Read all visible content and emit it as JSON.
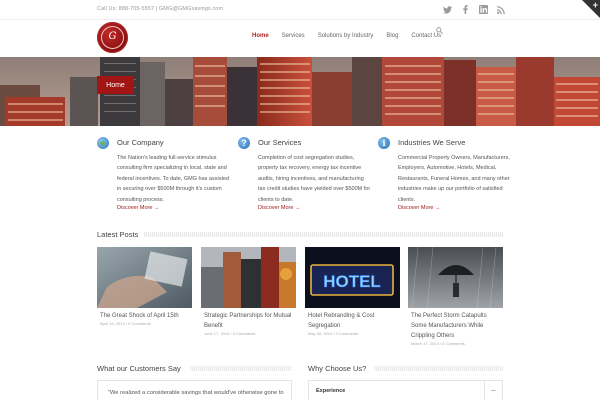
{
  "topbar": {
    "contact": "Call Us: 888-705-5557 | GMG@GMGsavings.com",
    "socials": [
      {
        "icon": "twitter-icon"
      },
      {
        "icon": "facebook-icon"
      },
      {
        "icon": "linkedin-icon"
      },
      {
        "icon": "rss-icon"
      }
    ]
  },
  "logo": {
    "text": "G"
  },
  "nav": {
    "items": [
      "Home",
      "Services",
      "Solutions by Industry",
      "Blog",
      "Contact Us"
    ],
    "active": "Home"
  },
  "banner": {
    "badge": "Home"
  },
  "columns": [
    {
      "title": "Our Company",
      "icon": "globe-icon",
      "icon_color": "#3f8fd2",
      "text": "The Nation's leading full-service stimulus consulting firm specializing in local, state and federal incentives. To date, GMG has assisted in securing over $500M through it's custom consulting process.",
      "more": "Discover More →"
    },
    {
      "title": "Our Services",
      "icon": "question-icon",
      "icon_color": "#3a86c8",
      "text": "Completion of cost segregation studies, property tax recovery, energy tax incentive audits, hiring incentives, and manufacturing tax credit studies have yielded over $500M for clients to date.",
      "more": "Discover More →"
    },
    {
      "title": "Industries We Serve",
      "icon": "info-icon",
      "icon_color": "#2f7fc6",
      "text": "Commercial Property Owners, Manufacturers, Employers, Automotive, Hotels, Medical, Restaurants, Funeral Homes, and many other industries make up our portfolio of satisfied clients.",
      "more": "Discover More →"
    }
  ],
  "latest_posts": {
    "heading": "Latest Posts",
    "posts": [
      {
        "title": "The Great Shock of April 15th",
        "meta": "April 16, 2014 / 0 Comments"
      },
      {
        "title": "Strategic Partnerships for Mutual Benefit",
        "meta": "June 17, 2014 / 0 Comments"
      },
      {
        "title": "Hotel Rebranding & Cost Segregation",
        "meta": "May 30, 2014 / 0 Comments"
      },
      {
        "title": "The Perfect Storm Catapults Some Manufacturers While Crippling Others",
        "meta": "March 17, 2014 / 0 Comments"
      }
    ],
    "hotel_sign": "HOTEL"
  },
  "testimonials": {
    "heading": "What our Customers Say",
    "quote": "“We realized a considerable savings that would've otherwise gone to"
  },
  "why": {
    "heading": "Why Choose Us?",
    "items": [
      {
        "label": "Experience",
        "toggle": "–"
      }
    ]
  },
  "colors": {
    "accent": "#a11515",
    "link": "#a01b1b",
    "nav_active": "#b12020"
  }
}
